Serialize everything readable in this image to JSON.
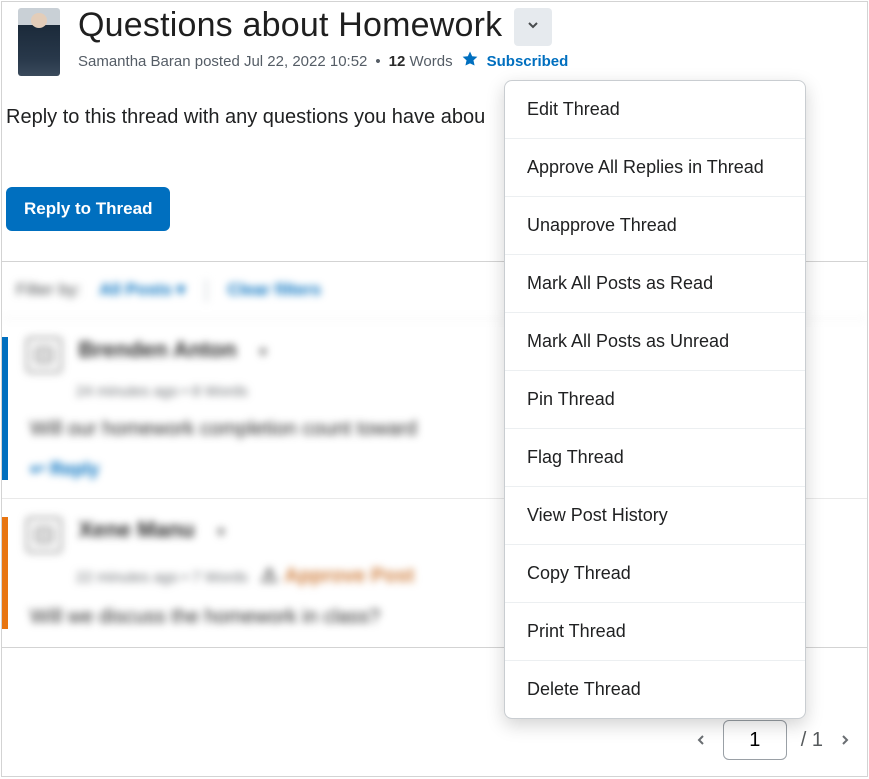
{
  "thread": {
    "title": "Questions about Homework",
    "author": "Samantha Baran",
    "posted_verb": "posted",
    "posted_at": "Jul 22, 2022 10:52",
    "word_count": "12",
    "words_label": "Words",
    "subscribed_label": "Subscribed",
    "body": "Reply to this thread with any questions you have abou"
  },
  "actions": {
    "reply_to_thread": "Reply to Thread",
    "reply": "Reply",
    "approve_post": "Approve Post"
  },
  "filter": {
    "label": "Filter by:",
    "all_posts": "All Posts",
    "clear": "Clear filters"
  },
  "replies": [
    {
      "author": "Brenden Anton",
      "time": "24 minutes ago",
      "words": "8 Words",
      "body": "Will our homework completion count toward"
    },
    {
      "author": "Xene Manu",
      "time": "22 minutes ago",
      "words": "7 Words",
      "body": "Will we discuss the homework in class?"
    }
  ],
  "menu": [
    "Edit Thread",
    "Approve All Replies in Thread",
    "Unapprove Thread",
    "Mark All Posts as Read",
    "Mark All Posts as Unread",
    "Pin Thread",
    "Flag Thread",
    "View Post History",
    "Copy Thread",
    "Print Thread",
    "Delete Thread"
  ],
  "pagination": {
    "current": "1",
    "total": "1"
  },
  "colors": {
    "primary": "#006fbf",
    "warning": "#e87511",
    "callout": "#b02a2a"
  }
}
